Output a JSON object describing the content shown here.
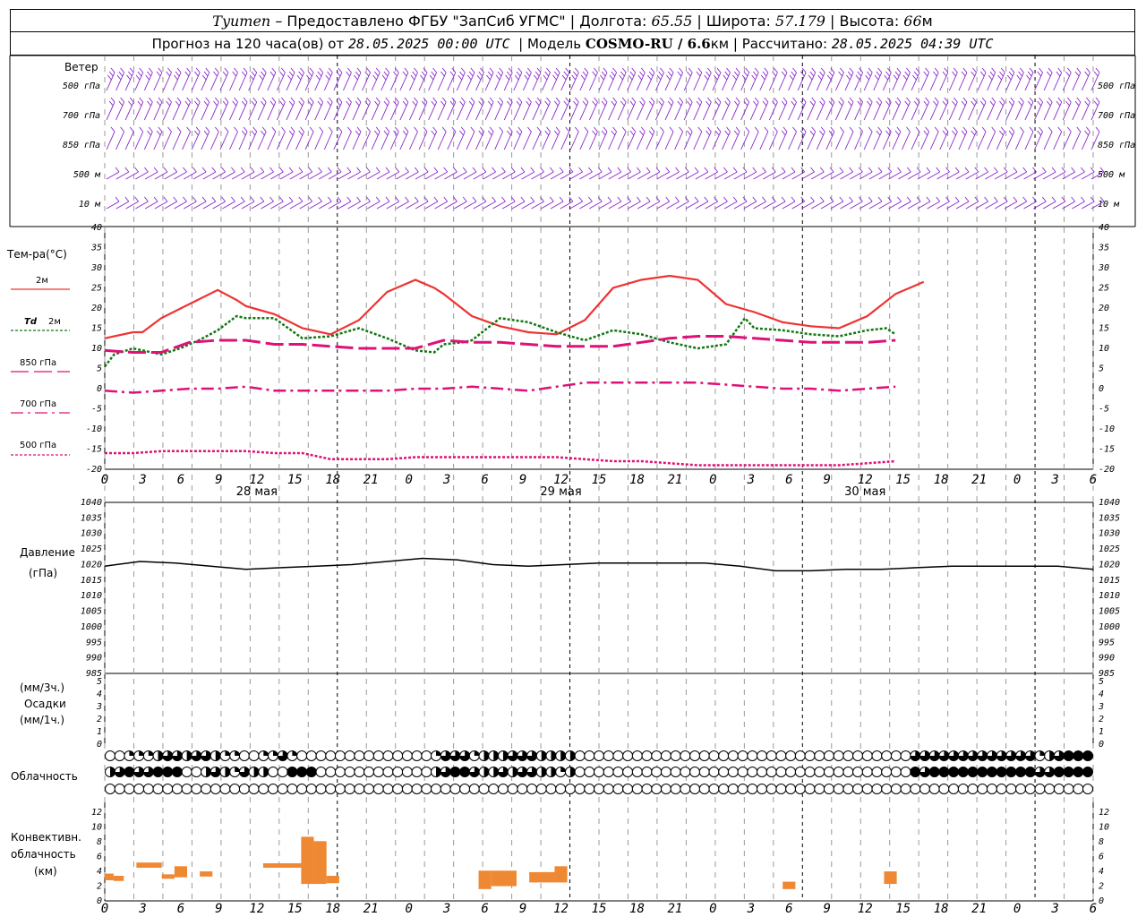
{
  "header": {
    "station": "Tyumen",
    "provider": " – Предоставлено ФГБУ \"ЗапСиб УГМС\" | Долгота: ",
    "lon": "65.55",
    "lat_label": " | Широта: ",
    "lat": "57.179",
    "alt_label": " | Высота: ",
    "alt": "66",
    "alt_unit": "м",
    "forecast_label": "Прогноз на 120 часа(ов) от ",
    "start": "28.05.2025 00:00 UTC",
    "model_label": "  | Модель ",
    "model": "COSMO-RU / 6.6",
    "model_unit": "км",
    "calc_label": " | Рассчитано: ",
    "calc": "28.05.2025 04:39 UTC"
  },
  "labels": {
    "wind": "Ветер",
    "wind_levels": [
      "500 гПа",
      "700 гПа",
      "850 гПа",
      "500 м",
      "10   м"
    ],
    "temp": "Тем-ра(°C)",
    "t2m": "2м",
    "td": "Td",
    "td2m": "2м",
    "t850": "850 гПа",
    "t700": "700 гПа",
    "t500": "500 гПа",
    "pressure": "Давление",
    "pressure_unit": "(гПа)",
    "precip_unit3": "(мм/3ч.)",
    "precip": "Осадки",
    "precip_unit1": "(мм/1ч.)",
    "cloud": "Облачность",
    "conv1": "Конвективн.",
    "conv2": "облачность",
    "conv3": "(км)"
  },
  "colors": {
    "t2m": "#ee3333",
    "td": "#117711",
    "upper": "#dd1177",
    "wind": "#8822cc",
    "pressure": "#000000",
    "conv": "#ee8833",
    "grid": "#999999"
  },
  "x_axis": {
    "hours": [
      "0",
      "3",
      "6",
      "9",
      "12",
      "15",
      "18",
      "21",
      "0",
      "3",
      "6",
      "9",
      "12",
      "15",
      "18",
      "21",
      "0",
      "3",
      "6",
      "9",
      "12",
      "15",
      "18",
      "21",
      "0",
      "3",
      "6"
    ],
    "dates": [
      "28 мая",
      "29 мая",
      "30 мая"
    ]
  },
  "chart_data": [
    {
      "type": "line",
      "title": "Тем-ра(°C)",
      "x_unit": "hours from 28.05.2025 00:00 UTC",
      "ylim": [
        -20,
        40
      ],
      "yticks": [
        "40",
        "35",
        "30",
        "25",
        "20",
        "15",
        "10",
        "5",
        "0",
        "-5",
        "-10",
        "-15",
        "-20"
      ],
      "series": [
        {
          "name": "2м",
          "x": [
            0,
            3,
            4,
            6,
            9,
            12,
            14,
            15,
            18,
            21,
            24,
            27,
            30,
            33,
            35,
            36,
            39,
            42,
            45,
            48,
            51,
            54,
            57,
            60,
            63,
            66,
            69,
            72,
            75,
            78,
            81,
            84,
            87,
            90,
            93,
            96,
            99,
            102,
            104,
            105
          ],
          "values": [
            12.5,
            14,
            14,
            17.5,
            21,
            24.5,
            22,
            20.5,
            18.5,
            15,
            13.5,
            17,
            24,
            27,
            25,
            23.5,
            18,
            15.5,
            14,
            13.5,
            17,
            25,
            27,
            28,
            27,
            21,
            19,
            16.5,
            15.5,
            15,
            18,
            23.5,
            26.5,
            null,
            null,
            null,
            null,
            null,
            null,
            null
          ]
        },
        {
          "name": "Td 2м",
          "x": [
            0,
            1,
            3,
            6,
            8,
            10,
            12,
            14,
            15,
            18,
            21,
            24,
            27,
            30,
            33,
            35,
            36,
            38,
            39,
            42,
            45,
            48,
            51,
            54,
            57,
            60,
            63,
            66,
            68,
            69,
            72,
            75,
            78,
            81,
            83,
            84
          ],
          "values": [
            5.5,
            8.5,
            10,
            8.5,
            10,
            12,
            14.5,
            18,
            17.5,
            17.5,
            12.5,
            13,
            15,
            12.5,
            9.5,
            9.0,
            11,
            11.5,
            12,
            17.5,
            16.5,
            14,
            12,
            14.5,
            13.5,
            11.5,
            10,
            11,
            17.5,
            15,
            14.5,
            13.5,
            13,
            14.5,
            15,
            13.5
          ]
        },
        {
          "name": "850 гПа",
          "x": [
            0,
            3,
            6,
            9,
            12,
            15,
            18,
            21,
            24,
            27,
            30,
            33,
            36,
            39,
            42,
            45,
            48,
            51,
            54,
            57,
            60,
            63,
            66,
            69,
            72,
            75,
            78,
            81,
            84
          ],
          "values": [
            9.5,
            9,
            9,
            11.5,
            12,
            12,
            11,
            11,
            10.5,
            10,
            10,
            10,
            12,
            11.5,
            11.5,
            11,
            10.5,
            10.5,
            10.5,
            11.5,
            12.5,
            13,
            13,
            12.5,
            12,
            11.5,
            11.5,
            11.5,
            12
          ]
        },
        {
          "name": "700 гПа",
          "x": [
            0,
            3,
            6,
            9,
            12,
            15,
            18,
            21,
            24,
            27,
            30,
            33,
            36,
            39,
            42,
            45,
            48,
            51,
            54,
            57,
            60,
            63,
            66,
            69,
            72,
            75,
            78,
            81,
            84
          ],
          "values": [
            -0.5,
            -1,
            -0.5,
            0,
            0,
            0.5,
            -0.5,
            -0.5,
            -0.5,
            -0.5,
            -0.5,
            0,
            0,
            0.5,
            0,
            -0.5,
            0.5,
            1.5,
            1.5,
            1.5,
            1.5,
            1.5,
            1,
            0.5,
            0,
            0,
            -0.5,
            0,
            0.5
          ]
        },
        {
          "name": "500 гПа",
          "x": [
            0,
            3,
            6,
            9,
            12,
            15,
            18,
            21,
            24,
            27,
            30,
            33,
            36,
            39,
            42,
            45,
            48,
            51,
            54,
            57,
            60,
            63,
            66,
            69,
            72,
            75,
            78,
            81,
            84
          ],
          "values": [
            -16,
            -16,
            -15.5,
            -15.5,
            -15.5,
            -15.5,
            -16,
            -16,
            -17.5,
            -17.5,
            -17.5,
            -17,
            -17,
            -17,
            -17,
            -17,
            -17,
            -17.5,
            -18,
            -18,
            -18.5,
            -19,
            -19,
            -19,
            -19,
            -19,
            -19,
            -18.5,
            -18
          ]
        }
      ]
    },
    {
      "type": "line",
      "title": "Давление",
      "ylabel": "(гПа)",
      "ylim": [
        985,
        1040
      ],
      "yticks": [
        "1040",
        "1035",
        "1030",
        "1025",
        "1020",
        "1015",
        "1010",
        "1005",
        "1000",
        "995",
        "990",
        "985"
      ],
      "series": [
        {
          "name": "pressure",
          "x": [
            0,
            3,
            6,
            9,
            12,
            15,
            18,
            21,
            24,
            27,
            30,
            33,
            36,
            39,
            42,
            45,
            48,
            51,
            54,
            57,
            60,
            63,
            66,
            69,
            72,
            75,
            78,
            81,
            84
          ],
          "values": [
            1019.5,
            1021,
            1020.5,
            1019.5,
            1018.5,
            1019,
            1019.5,
            1020,
            1021,
            1022,
            1021.5,
            1020,
            1019.5,
            1020,
            1020.5,
            1020.5,
            1020.5,
            1020.5,
            1019.5,
            1018,
            1018,
            1018.5,
            1018.5,
            1019,
            1019.5,
            1019.5,
            1019.5,
            1019.5,
            1018.5
          ]
        }
      ]
    },
    {
      "type": "bar",
      "title": "Осадки",
      "ylim": [
        0,
        5
      ],
      "yticks": [
        "5",
        "4",
        "3",
        "2",
        "1",
        "0"
      ],
      "values": []
    },
    {
      "type": "bar",
      "title": "Конвективн. облачность",
      "ylabel": "(км)",
      "ylim": [
        0,
        13
      ],
      "yticks": [
        "12",
        "10",
        "8",
        "6",
        "4",
        "2",
        "0"
      ],
      "bars_km": [
        {
          "x0": 0,
          "x1": 0.7,
          "base": 2.8,
          "top": 3.7
        },
        {
          "x0": 0.7,
          "x1": 1.5,
          "base": 2.7,
          "top": 3.4
        },
        {
          "x0": 2.5,
          "x1": 4.5,
          "base": 4.5,
          "top": 5.2
        },
        {
          "x0": 4.5,
          "x1": 5.5,
          "base": 3.0,
          "top": 3.6
        },
        {
          "x0": 5.5,
          "x1": 6.5,
          "base": 3.2,
          "top": 4.7
        },
        {
          "x0": 7.5,
          "x1": 8.5,
          "base": 3.3,
          "top": 4.0
        },
        {
          "x0": 12.5,
          "x1": 15.5,
          "base": 4.5,
          "top": 5.1
        },
        {
          "x0": 15.5,
          "x1": 16.5,
          "base": 2.3,
          "top": 8.7
        },
        {
          "x0": 16.5,
          "x1": 17.5,
          "base": 2.3,
          "top": 8.1
        },
        {
          "x0": 17.5,
          "x1": 18.5,
          "base": 2.4,
          "top": 3.4
        },
        {
          "x0": 29.5,
          "x1": 30.5,
          "base": 1.6,
          "top": 4.1
        },
        {
          "x0": 30.5,
          "x1": 32.5,
          "base": 2.0,
          "top": 4.1
        },
        {
          "x0": 33.5,
          "x1": 35.5,
          "base": 2.5,
          "top": 3.9
        },
        {
          "x0": 35.5,
          "x1": 36.5,
          "base": 2.5,
          "top": 4.7
        },
        {
          "x0": 53.5,
          "x1": 54.5,
          "base": 1.6,
          "top": 2.6
        },
        {
          "x0": 61.5,
          "x1": 62.5,
          "base": 2.3,
          "top": 4.0
        }
      ]
    }
  ],
  "cloud_rows": [
    "0011123323321100113100000000000000133312223332222000000000000000000000000000000000003333333333333123444",
    "2343344400232132200444000000000000234432232332212000000000000000000000000000000000004344444444444334444",
    "0000000000000000000000000000000000000000000000000000000000000000000000000000000000000000000000000000000"
  ],
  "wind_rows": [
    "cccccbbcbbcbbbbccbbcccccbbcbccbbcccbbccccccccccccccbccccccccbbbcccccccbbcbcccbccccccccbbbbbbbcccccbbbbbbb",
    "bbbbbbbbbbbbbbbbbbbbbbbbbbbbbbbbbbbbbbbbbbbbbbbbbbbbbbbbbbbbbbbbbbbbbbbbbbbbbbbbbbbbbbbbbbbbbbbbbbbbbbbbb",
    "aaaabbaaabbaaabbbaabbaaaaababbbbaabaababbabbaabbaaabbbabbbaaababbbbaaaababbbbaaaabbbaababbbbaabbaabaaaaba",
    "aaaaaaaaaaaaaaaaaaaaaaaaaaaaaaaaaaaaaaaaaaaaaaaaaaaaaaaaaaaaaaaaaaaaaaaaaaaaaaaaaaaaaaaaaaaaaaaaaaaaaaa",
    "aaaaaaaaaaaaaaaaaaaaaaaaaaaaaaaaaaaaaaaaaaaaaaaaaaaaaaaaaaaaaaaaaaaaaaaaaaaaaaaaaaaaaaaaaaaaaaaaaaaaaaa"
  ]
}
